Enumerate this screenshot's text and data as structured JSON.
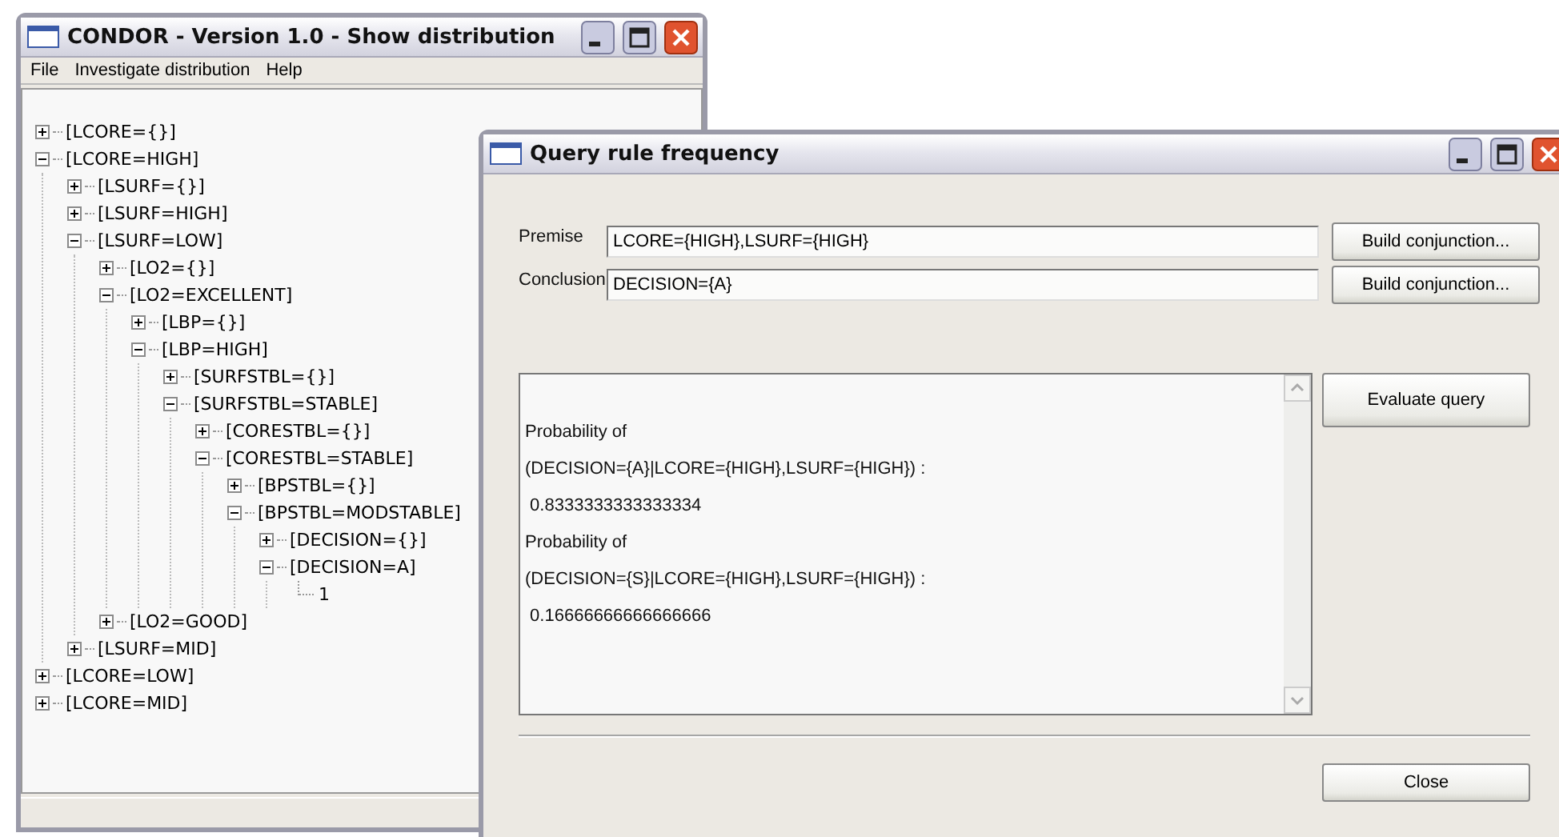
{
  "main_window": {
    "title": "CONDOR - Version 1.0 - Show distribution",
    "menu": [
      "File",
      "Investigate distribution",
      "Help"
    ],
    "tree": [
      {
        "label": "[LCORE={}]",
        "expanded": false
      },
      {
        "label": "[LCORE=HIGH]",
        "expanded": true,
        "children": [
          {
            "label": "[LSURF={}]",
            "expanded": false
          },
          {
            "label": "[LSURF=HIGH]",
            "expanded": false
          },
          {
            "label": "[LSURF=LOW]",
            "expanded": true,
            "children": [
              {
                "label": "[LO2={}]",
                "expanded": false
              },
              {
                "label": "[LO2=EXCELLENT]",
                "expanded": true,
                "children": [
                  {
                    "label": "[LBP={}]",
                    "expanded": false
                  },
                  {
                    "label": "[LBP=HIGH]",
                    "expanded": true,
                    "children": [
                      {
                        "label": "[SURFSTBL={}]",
                        "expanded": false
                      },
                      {
                        "label": "[SURFSTBL=STABLE]",
                        "expanded": true,
                        "children": [
                          {
                            "label": "[CORESTBL={}]",
                            "expanded": false
                          },
                          {
                            "label": "[CORESTBL=STABLE]",
                            "expanded": true,
                            "children": [
                              {
                                "label": "[BPSTBL={}]",
                                "expanded": false
                              },
                              {
                                "label": "[BPSTBL=MODSTABLE]",
                                "expanded": true,
                                "children": [
                                  {
                                    "label": "[DECISION={}]",
                                    "expanded": false
                                  },
                                  {
                                    "label": "[DECISION=A]",
                                    "expanded": true,
                                    "children": [
                                      {
                                        "label": "1"
                                      }
                                    ]
                                  }
                                ]
                              }
                            ]
                          }
                        ]
                      }
                    ]
                  }
                ]
              },
              {
                "label": "[LO2=GOOD]",
                "expanded": false
              }
            ]
          },
          {
            "label": "[LSURF=MID]",
            "expanded": false
          }
        ]
      },
      {
        "label": "[LCORE=LOW]",
        "expanded": false
      },
      {
        "label": "[LCORE=MID]",
        "expanded": false
      }
    ]
  },
  "dialog": {
    "title": "Query rule frequency",
    "fields": [
      {
        "label": "Premise",
        "value": "LCORE={HIGH},LSURF={HIGH}",
        "button": "Build conjunction..."
      },
      {
        "label": "Conclusion",
        "value": "DECISION={A}",
        "button": "Build conjunction..."
      }
    ],
    "output": [
      "Probability of",
      "(DECISION={A}|LCORE={HIGH},LSURF={HIGH}) :",
      " 0.8333333333333334",
      "Probability of",
      "(DECISION={S}|LCORE={HIGH},LSURF={HIGH}) :",
      " 0.16666666666666666"
    ],
    "evaluate_button": "Evaluate query",
    "close_button": "Close"
  }
}
